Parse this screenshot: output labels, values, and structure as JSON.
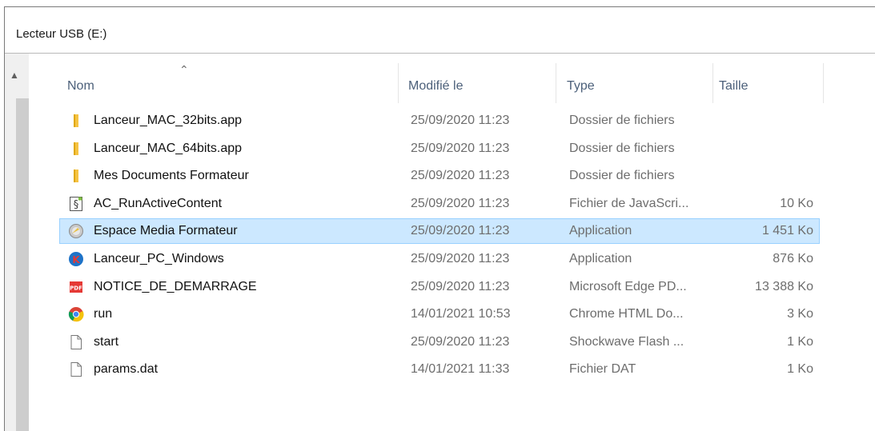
{
  "window": {
    "title": "Lecteur USB (E:)"
  },
  "columns": {
    "name": "Nom",
    "modified": "Modifié le",
    "type": "Type",
    "size": "Taille"
  },
  "files": [
    {
      "name": "Lanceur_MAC_32bits.app",
      "modified": "25/09/2020 11:23",
      "type": "Dossier de fichiers",
      "size": "",
      "icon": "folder-icon"
    },
    {
      "name": "Lanceur_MAC_64bits.app",
      "modified": "25/09/2020 11:23",
      "type": "Dossier de fichiers",
      "size": "",
      "icon": "folder-icon"
    },
    {
      "name": "Mes Documents Formateur",
      "modified": "25/09/2020 11:23",
      "type": "Dossier de fichiers",
      "size": "",
      "icon": "folder-icon"
    },
    {
      "name": "AC_RunActiveContent",
      "modified": "25/09/2020 11:23",
      "type": "Fichier de JavaScri...",
      "size": "10 Ko",
      "icon": "javascript-file-icon"
    },
    {
      "name": "Espace Media Formateur",
      "modified": "25/09/2020 11:23",
      "type": "Application",
      "size": "1 451 Ko",
      "icon": "application-icon",
      "selected": true
    },
    {
      "name": "Lanceur_PC_Windows",
      "modified": "25/09/2020 11:23",
      "type": "Application",
      "size": "876 Ko",
      "icon": "launcher-app-icon"
    },
    {
      "name": "NOTICE_DE_DEMARRAGE",
      "modified": "25/09/2020 11:23",
      "type": "Microsoft Edge PD...",
      "size": "13 388 Ko",
      "icon": "pdf-icon"
    },
    {
      "name": "run",
      "modified": "14/01/2021 10:53",
      "type": "Chrome HTML Do...",
      "size": "3 Ko",
      "icon": "chrome-icon"
    },
    {
      "name": "start",
      "modified": "25/09/2020 11:23",
      "type": "Shockwave Flash ...",
      "size": "1 Ko",
      "icon": "blank-file-icon"
    },
    {
      "name": "params.dat",
      "modified": "14/01/2021 11:33",
      "type": "Fichier DAT",
      "size": "1 Ko",
      "icon": "blank-file-icon"
    }
  ]
}
